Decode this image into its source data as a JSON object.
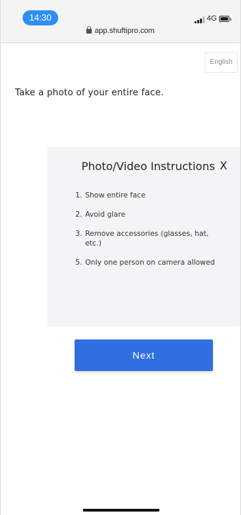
{
  "status_bar": {
    "time": "14:30",
    "network": "4G",
    "signal_icon": "signal-bars-icon",
    "battery_icon": "battery-icon"
  },
  "browser": {
    "url": "app.shuftipro.com",
    "lock_icon": "lock-icon"
  },
  "language_selector": {
    "label": "English"
  },
  "prompt": "Take a photo of your entire face.",
  "instructions": {
    "title": "Photo/Video Instructions",
    "close_label": "X",
    "steps": [
      {
        "number": "1.",
        "text": "Show entire face"
      },
      {
        "number": "2.",
        "text": "Avoid glare"
      },
      {
        "number": "3.",
        "text": "Remove accessories (glasses, hat, etc.)"
      },
      {
        "number": "5.",
        "text": "Only one person on camera allowed"
      }
    ]
  },
  "actions": {
    "next_label": "Next"
  },
  "colors": {
    "accent": "#2f6fe0",
    "time_pill": "#2f8ff0",
    "panel_bg": "#f4f4f6"
  }
}
